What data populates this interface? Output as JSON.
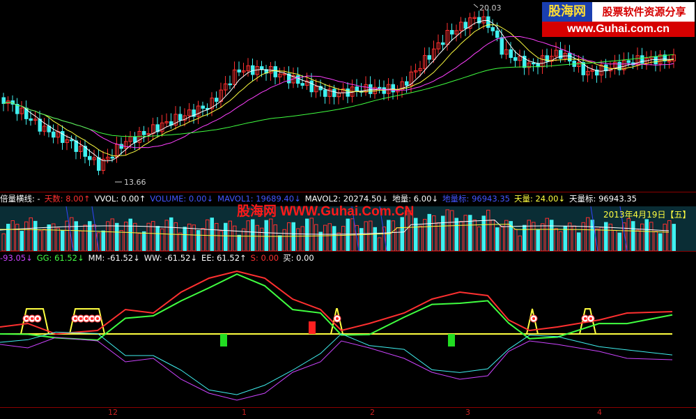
{
  "main_chart": {
    "high_label": "20.03",
    "low_label": "13.66"
  },
  "watermark": {
    "brand": "股海网",
    "slogan": "股票软件资源分享",
    "url": "www.Guhai.com.cn",
    "overlay_text": "股海网 WWW.Guhai.Com.CN"
  },
  "volume_indicator": {
    "segments": [
      {
        "label": "倍量横线: -",
        "color": "#ffffff"
      },
      {
        "label": "天数: 8.00↑",
        "color": "#ff3030"
      },
      {
        "label": "VVOL: 0.00↑",
        "color": "#ffffff"
      },
      {
        "label": "VOLUME: 0.00↓",
        "color": "#4455ff"
      },
      {
        "label": "MAVOL1: 19689.40↓",
        "color": "#4455ff"
      },
      {
        "label": "MAVOL2: 20274.50↓",
        "color": "#ffffff"
      },
      {
        "label": "地量: 6.00↓",
        "color": "#ffffff"
      },
      {
        "label": "地量标: 96943.35",
        "color": "#4455ff"
      },
      {
        "label": "天量: 24.00↓",
        "color": "#ffff40"
      },
      {
        "label": "天量标: 96943.35",
        "color": "#ffffff"
      }
    ],
    "date": "2013年4月19日【五】"
  },
  "lower_indicator": {
    "segments": [
      {
        "label": "-93.05↓",
        "color": "#cc44ff"
      },
      {
        "label": "GG: 61.52↓",
        "color": "#44ff44"
      },
      {
        "label": "MM: -61.52↓",
        "color": "#ffffff"
      },
      {
        "label": "WW: -61.52↓",
        "color": "#ffffff"
      },
      {
        "label": "EE: 61.52↑",
        "color": "#ffffff"
      },
      {
        "label": "S: 0.00",
        "color": "#ff3030"
      },
      {
        "label": "买: 0.00",
        "color": "#ffffff"
      }
    ]
  },
  "time_axis": {
    "labels": [
      "12",
      "1",
      "2",
      "3",
      "4"
    ]
  },
  "colors": {
    "up": "#ff3030",
    "down": "#40f0f0",
    "ma5": "#ffffff",
    "ma10": "#ffff40",
    "ma20": "#ff40ff",
    "ma60": "#40ff40",
    "grid": "#8a0000"
  }
}
